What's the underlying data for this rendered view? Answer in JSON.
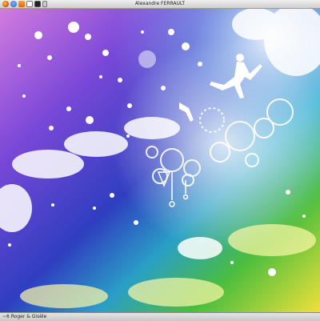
{
  "top_panel": {
    "title": "Alexandre FERRAULT",
    "launchers": [
      "firefox-icon",
      "thunderbird-icon",
      "music-player-icon",
      "document-icon",
      "terminal-icon",
      "settings-icon"
    ]
  },
  "bottom_panel": {
    "task_label": "~6 Roger & Gisèle"
  },
  "wallpaper": {
    "colors": {
      "magenta": "#c36ad8",
      "violet": "#6a3fd0",
      "blue": "#2a2bb5",
      "teal": "#2fb7c9",
      "green": "#4fbf3a",
      "yellow": "#f2e13a",
      "cloud": "#ffffff"
    }
  }
}
